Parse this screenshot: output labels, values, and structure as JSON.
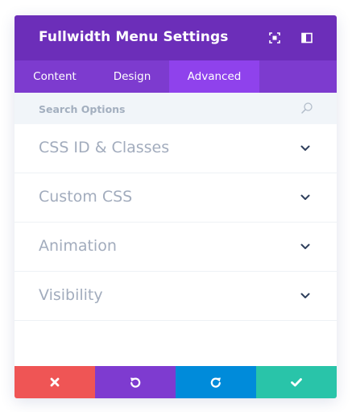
{
  "header": {
    "title": "Fullwidth Menu Settings",
    "icons": [
      "expand-icon",
      "sidebar-toggle-icon"
    ]
  },
  "tabs": [
    {
      "label": "Content",
      "active": false
    },
    {
      "label": "Design",
      "active": false
    },
    {
      "label": "Advanced",
      "active": true
    }
  ],
  "search": {
    "placeholder": "Search Options",
    "icon": "search-icon"
  },
  "sections": [
    {
      "label": "CSS ID & Classes",
      "icon": "chevron-down-icon"
    },
    {
      "label": "Custom CSS",
      "icon": "chevron-down-icon"
    },
    {
      "label": "Animation",
      "icon": "chevron-down-icon"
    },
    {
      "label": "Visibility",
      "icon": "chevron-down-icon"
    }
  ],
  "footer": {
    "buttons": [
      {
        "name": "cancel",
        "icon": "close-icon",
        "color": "#ef5555"
      },
      {
        "name": "undo",
        "icon": "undo-icon",
        "color": "#7e3bd0"
      },
      {
        "name": "redo",
        "icon": "redo-icon",
        "color": "#008bda"
      },
      {
        "name": "save",
        "icon": "check-icon",
        "color": "#29c4a9"
      }
    ]
  },
  "colors": {
    "header_bg": "#6c2eb9",
    "tabs_bg": "#7d3bcf",
    "active_tab_bg": "#8f42ec",
    "search_bg": "#f1f5f9",
    "label_text": "#a2acbd",
    "chevron": "#2f3f5c"
  }
}
